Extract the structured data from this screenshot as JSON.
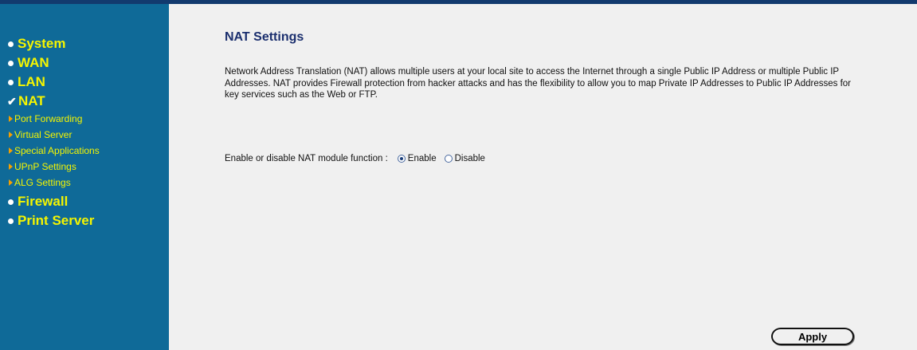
{
  "sidebar": {
    "items": [
      {
        "label": "System",
        "active": false
      },
      {
        "label": "WAN",
        "active": false
      },
      {
        "label": "LAN",
        "active": false
      },
      {
        "label": "NAT",
        "active": true
      },
      {
        "label": "Firewall",
        "active": false
      },
      {
        "label": "Print Server",
        "active": false
      }
    ],
    "nat_subitems": [
      "Port Forwarding",
      "Virtual Server",
      "Special Applications",
      "UPnP Settings",
      "ALG Settings"
    ],
    "colors": {
      "background": "#0f6a98",
      "text": "#f5f500"
    }
  },
  "main": {
    "title": "NAT Settings",
    "description": "Network Address Translation (NAT) allows multiple users at your local site to access the Internet through a single Public IP Address or multiple Public IP Addresses. NAT provides Firewall protection from hacker attacks and has the flexibility to allow you to map Private IP Addresses to Public IP Addresses for key services such as the Web or FTP.",
    "nat_function": {
      "label": "Enable or disable NAT module function :",
      "options": [
        {
          "label": "Enable",
          "selected": true
        },
        {
          "label": "Disable",
          "selected": false
        }
      ]
    },
    "apply_label": "Apply"
  }
}
